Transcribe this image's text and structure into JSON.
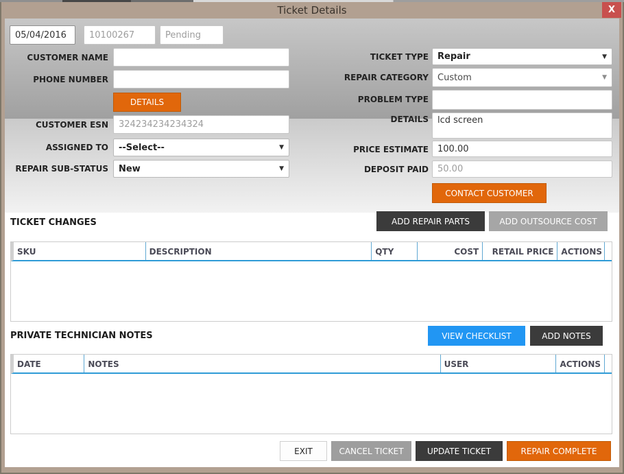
{
  "window": {
    "title": "Ticket Details",
    "close_label": "X"
  },
  "header_fields": {
    "date": "05/04/2016",
    "ticket_number": "10100267",
    "status": "Pending"
  },
  "left_form": {
    "customer_name": {
      "label": "CUSTOMER NAME",
      "value": ""
    },
    "phone_number": {
      "label": "PHONE NUMBER",
      "value": ""
    },
    "details_button": "DETAILS",
    "customer_esn": {
      "label": "CUSTOMER ESN",
      "value": "324234234234324"
    },
    "assigned_to": {
      "label": "ASSIGNED TO",
      "value": "--Select--"
    },
    "repair_sub_status": {
      "label": "REPAIR SUB-STATUS",
      "value": "New"
    }
  },
  "right_form": {
    "ticket_type": {
      "label": "TICKET TYPE",
      "value": "Repair"
    },
    "repair_category": {
      "label": "REPAIR CATEGORY",
      "value": "Custom"
    },
    "problem_type": {
      "label": "PROBLEM TYPE",
      "value": ""
    },
    "details": {
      "label": "DETAILS",
      "value": "lcd screen"
    },
    "price_estimate": {
      "label": "PRICE ESTIMATE",
      "value": "100.00"
    },
    "deposit_paid": {
      "label": "DEPOSIT PAID",
      "value": "50.00"
    },
    "contact_customer_button": "CONTACT CUSTOMER"
  },
  "ticket_changes": {
    "title": "TICKET CHANGES",
    "add_repair_parts_button": "ADD REPAIR PARTS",
    "add_outsource_cost_button": "ADD OUTSOURCE COST",
    "columns": [
      "SKU",
      "DESCRIPTION",
      "QTY",
      "COST",
      "RETAIL PRICE",
      "ACTIONS"
    ],
    "rows": []
  },
  "technician_notes": {
    "title": "PRIVATE TECHNICIAN NOTES",
    "view_checklist_button": "VIEW CHECKLIST",
    "add_notes_button": "ADD NOTES",
    "columns": [
      "DATE",
      "NOTES",
      "USER",
      "ACTIONS"
    ],
    "rows": []
  },
  "footer": {
    "exit_button": "EXIT",
    "cancel_ticket_button": "CANCEL TICKET",
    "update_ticket_button": "UPDATE TICKET",
    "repair_complete_button": "REPAIR COMPLETE"
  },
  "colors": {
    "accent_orange": "#e1670b",
    "accent_blue": "#2196f3",
    "button_dark": "#3b3b3b",
    "button_gray": "#a6a6a6",
    "title_bar_tan": "#b2a091",
    "close_red": "#c8504e",
    "table_header_border_blue": "#2e9bd6"
  }
}
